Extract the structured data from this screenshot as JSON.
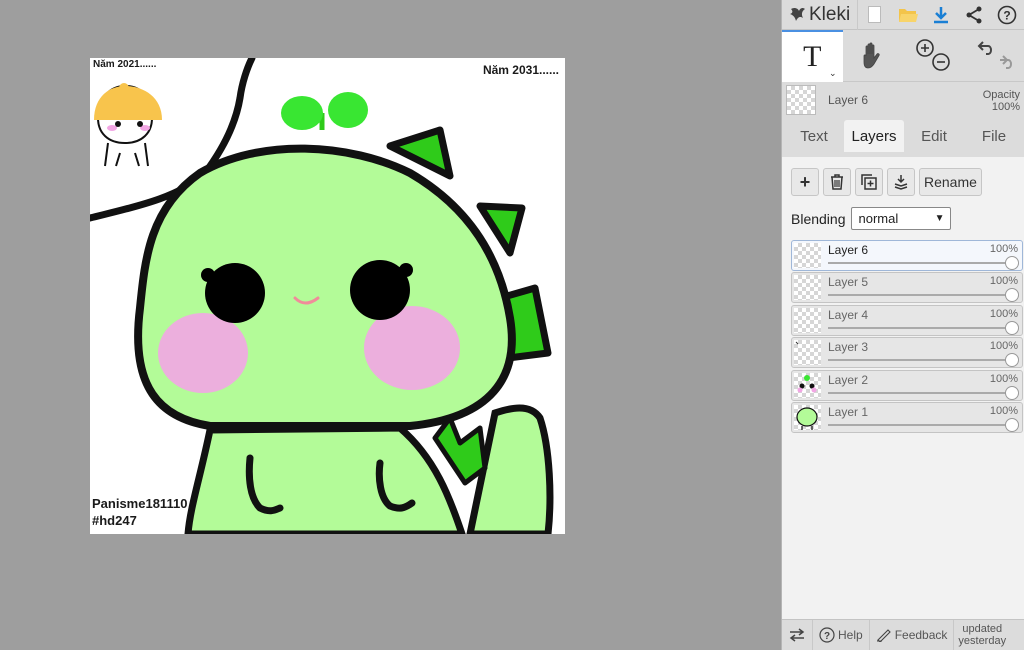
{
  "app": {
    "name": "Kleki"
  },
  "canvas": {
    "top_left_text": "Năm 2021......",
    "top_right_text": "Năm 2031......",
    "bottom_text_1": "Panisme181110",
    "bottom_text_2": "#hd247"
  },
  "tools": {
    "text_tool": "T"
  },
  "layer_info": {
    "name": "Layer 6",
    "opacity_label": "Opacity",
    "opacity_value": "100%"
  },
  "tabs": [
    "Text",
    "Layers",
    "Edit",
    "File"
  ],
  "active_tab": "Layers",
  "layer_actions": {
    "add": "+",
    "rename": "Rename"
  },
  "blending": {
    "label": "Blending",
    "value": "normal"
  },
  "layers": [
    {
      "name": "Layer 6",
      "opacity": "100%",
      "opacity_fraction": 1.0,
      "selected": true
    },
    {
      "name": "Layer 5",
      "opacity": "100%",
      "opacity_fraction": 1.0,
      "selected": false
    },
    {
      "name": "Layer 4",
      "opacity": "100%",
      "opacity_fraction": 1.0,
      "selected": false
    },
    {
      "name": "Layer 3",
      "opacity": "100%",
      "opacity_fraction": 1.0,
      "selected": false
    },
    {
      "name": "Layer 2",
      "opacity": "100%",
      "opacity_fraction": 1.0,
      "selected": false
    },
    {
      "name": "Layer 1",
      "opacity": "100%",
      "opacity_fraction": 1.0,
      "selected": false
    }
  ],
  "bottom": {
    "help": "Help",
    "feedback": "Feedback",
    "updated_1": "updated",
    "updated_2": "yesterday"
  },
  "colors": {
    "accent": "#1a7fd4",
    "dino_green": "#b3fb98",
    "spike_green": "#2fcb1a",
    "blush_pink": "#f2a6e4",
    "hat_orange": "#f8c44c"
  }
}
